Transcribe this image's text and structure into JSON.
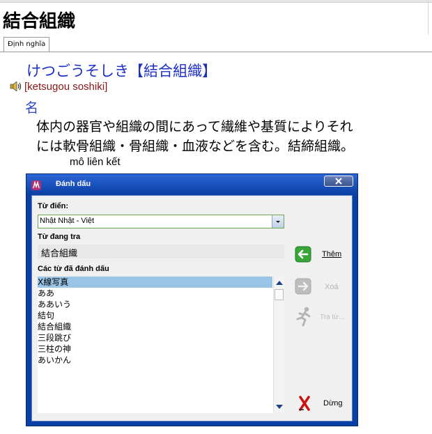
{
  "entry": {
    "title": "結合組織",
    "tab_label": "Định nghĩa",
    "headword": "けつごうそしき【結合組織】",
    "reading": "[ketsugou soshiki]",
    "part_of_speech": "名",
    "definition_line1": "体内の器官や組織の間にあって繊維や基質によりそれ",
    "definition_line2": "には軟骨組織・骨組織・血液などを含む。結締組織。",
    "meaning": "mô liên kết"
  },
  "dialog": {
    "title": "Đánh dấu",
    "dictionary_label": "Từ điển:",
    "dictionary_value": "Nhật Nhật - Việt",
    "current_word_label": "Từ đang tra",
    "current_word": "結合組織",
    "bookmarks_label": "Các từ đã đánh dấu",
    "bookmarks": [
      "X線写真",
      "ああ",
      "ああいう",
      "結句",
      "結合組織",
      "三段跳び",
      "三柱の神",
      "あいかん"
    ],
    "selected_index": 0,
    "buttons": {
      "add": "Thêm",
      "delete": "Xoá",
      "lookup": "Tra từ...",
      "stop": "Dừng"
    }
  },
  "colors": {
    "headword": "#1c2fc7",
    "reading": "#8b1515",
    "dialog_frame": "#0a3fa3",
    "selection": "#99c4e6",
    "add_icon": "#3aa63a",
    "stop_icon": "#cc1111"
  }
}
